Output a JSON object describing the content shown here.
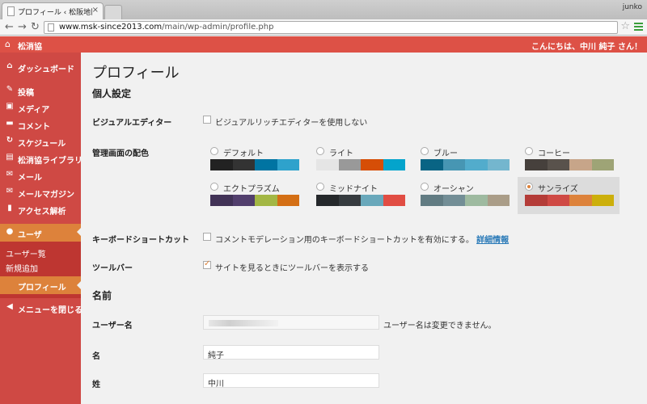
{
  "browser": {
    "tab_title": "プロフィール ‹ 松阪地区広報",
    "tab_close": "×",
    "user_chip": "junko",
    "url_host": "www.msk-since2013.com",
    "url_path": "/main/wp-admin/profile.php"
  },
  "adminbar": {
    "site_name": "松消協",
    "greeting": "こんにちは、中川 純子 さん！"
  },
  "sidebar": {
    "items": [
      {
        "label": "ダッシュボード",
        "icon": "⌂"
      },
      {
        "label": "投稿",
        "icon": "✎"
      },
      {
        "label": "メディア",
        "icon": "▣"
      },
      {
        "label": "コメント",
        "icon": "▬"
      },
      {
        "label": "スケジュール",
        "icon": "↻"
      },
      {
        "label": "松消協ライブラリ",
        "icon": "▤"
      },
      {
        "label": "メール",
        "icon": "✉"
      },
      {
        "label": "メールマガジン",
        "icon": "✉"
      },
      {
        "label": "アクセス解析",
        "icon": "▮"
      },
      {
        "label": "ユーザ",
        "icon": "●"
      }
    ],
    "submenu": [
      "ユーザー覧",
      "新規追加",
      "プロフィール"
    ],
    "collapse": "メニューを閉じる"
  },
  "page": {
    "title": "プロフィール",
    "section_personal": "個人設定",
    "section_name": "名前"
  },
  "settings": {
    "visual_editor_label": "ビジュアルエディター",
    "visual_editor_text": "ビジュアルリッチエディターを使用しない",
    "color_scheme_label": "管理画面の配色",
    "keyboard_label": "キーボードショートカット",
    "keyboard_text": "コメントモデレーション用のキーボードショートカットを有効にする。",
    "keyboard_link": "詳細情報",
    "toolbar_label": "ツールバー",
    "toolbar_text": "サイトを見るときにツールバーを表示する"
  },
  "color_schemes": [
    {
      "name": "デフォルト",
      "colors": [
        "#222222",
        "#333333",
        "#0074a2",
        "#2ea2cc"
      ],
      "selected": false
    },
    {
      "name": "ライト",
      "colors": [
        "#e5e5e5",
        "#999999",
        "#d64e07",
        "#04a4cc"
      ],
      "selected": false
    },
    {
      "name": "ブルー",
      "colors": [
        "#096484",
        "#4796b3",
        "#52accc",
        "#74b6ce"
      ],
      "selected": false
    },
    {
      "name": "コーヒー",
      "colors": [
        "#46403c",
        "#59524c",
        "#c7a589",
        "#9ea476"
      ],
      "selected": false
    },
    {
      "name": "エクトプラズム",
      "colors": [
        "#413256",
        "#523f6d",
        "#a3b745",
        "#d46f15"
      ],
      "selected": false
    },
    {
      "name": "ミッドナイト",
      "colors": [
        "#25282b",
        "#363b3f",
        "#69a8bb",
        "#e14d43"
      ],
      "selected": false
    },
    {
      "name": "オーシャン",
      "colors": [
        "#627c83",
        "#738e96",
        "#9ebaa0",
        "#aa9d88"
      ],
      "selected": false
    },
    {
      "name": "サンライズ",
      "colors": [
        "#b43c38",
        "#cf4944",
        "#dd823b",
        "#ccaf0b"
      ],
      "selected": true
    }
  ],
  "name_fields": {
    "username_label": "ユーザー名",
    "username_note": "ユーザー名は変更できません。",
    "first_name_label": "名",
    "first_name_value": "純子",
    "last_name_label": "姓",
    "last_name_value": "中川"
  },
  "colors": {
    "adminbar": "#dd5146",
    "sidebar": "#cf4944",
    "highlight": "#dd823b"
  }
}
